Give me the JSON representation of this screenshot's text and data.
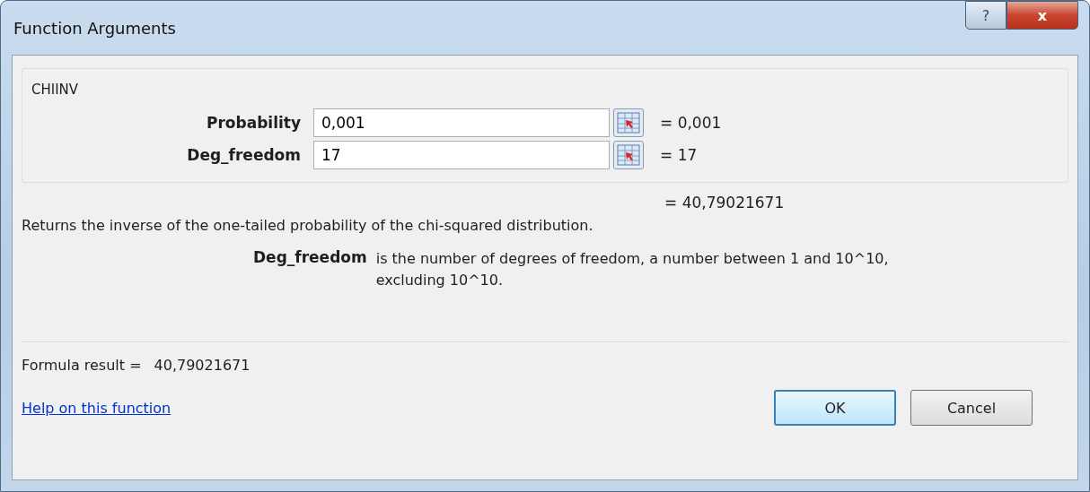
{
  "window": {
    "title": "Function Arguments",
    "buttons": [
      "?",
      "x"
    ]
  },
  "function_name": "CHIINV",
  "arguments": [
    {
      "label": "Probability",
      "value": "0,001",
      "result": "= 0,001"
    },
    {
      "label": "Deg_freedom",
      "value": "17",
      "result": "= 17"
    }
  ],
  "function_result": "= 40,79021671",
  "description": "Returns the inverse of the one-tailed probability of the chi-squared distribution.",
  "argument_help": {
    "name": "Deg_freedom",
    "text": "is the number of degrees of freedom, a number between 1 and 10^10, excluding 10^10."
  },
  "formula_result": {
    "label": "Formula result =",
    "value": "40,79021671"
  },
  "help_link": "Help on this function",
  "buttons": [
    {
      "label": "OK",
      "selected": true
    },
    {
      "label": "Cancel",
      "selected": false
    }
  ]
}
